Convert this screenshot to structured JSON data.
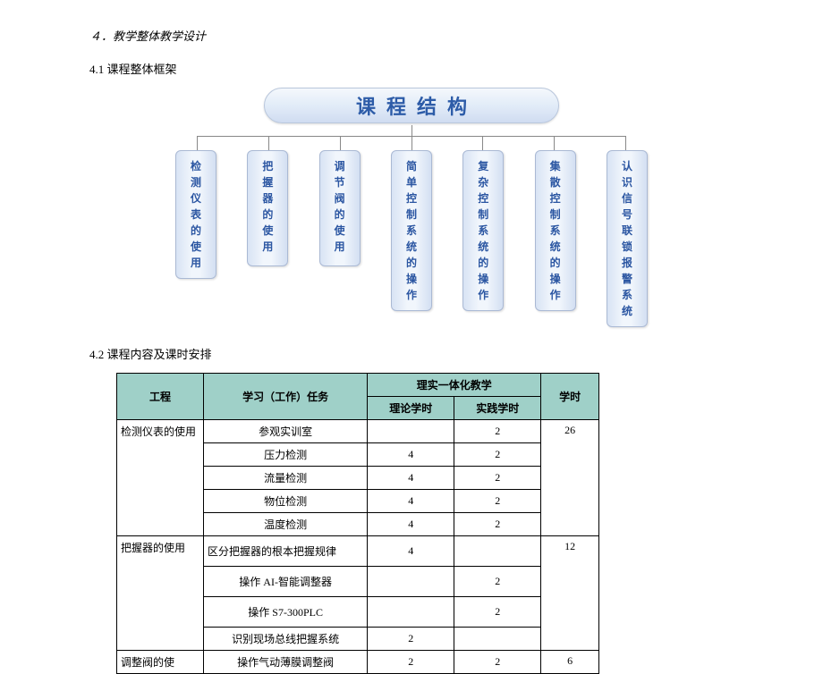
{
  "headings": {
    "section4": "４．教学整体教学设计",
    "sub41": "4.1  课程整体框架",
    "sub42": "4.2  课程内容及课时安排"
  },
  "diagram": {
    "title": "课程结构",
    "boxes": [
      [
        "检",
        "测",
        "仪",
        "表",
        "的",
        "使",
        "用"
      ],
      [
        "把",
        "握",
        "器",
        "的",
        "使",
        "用"
      ],
      [
        "调",
        "节",
        "阀",
        "的",
        "使",
        "用"
      ],
      [
        "简",
        "单",
        "控",
        "制",
        "系",
        "统",
        "的",
        "操",
        "作"
      ],
      [
        "复",
        "杂",
        "控",
        "制",
        "系",
        "统",
        "的",
        "操",
        "作"
      ],
      [
        "集",
        "散",
        "控",
        "制",
        "系",
        "统",
        "的",
        "操",
        "作"
      ],
      [
        "认",
        "识",
        "信",
        "号",
        "联",
        "锁",
        "报",
        "警",
        "系",
        "统"
      ]
    ]
  },
  "table": {
    "headers": {
      "col_project": "工程",
      "col_task": "学习（工作）任务",
      "col_integrated": "理实一体化教学",
      "col_theory": "理论学时",
      "col_practice": "实践学时",
      "col_hours": "学时"
    },
    "rows": [
      {
        "project": "检测仪表的使用",
        "task": "参观实训室",
        "theory": "",
        "practice": "2",
        "hours": "26",
        "project_rowspan": 5,
        "hours_rowspan": 5
      },
      {
        "task": "压力检测",
        "theory": "4",
        "practice": "2"
      },
      {
        "task": "流量检测",
        "theory": "4",
        "practice": "2"
      },
      {
        "task": "物位检测",
        "theory": "4",
        "practice": "2"
      },
      {
        "task": "温度检测",
        "theory": "4",
        "practice": "2"
      },
      {
        "project": "把握器的使用",
        "task": "区分把握器的根本把握规律",
        "theory": "4",
        "practice": "",
        "hours": "12",
        "project_rowspan": 4,
        "hours_rowspan": 4,
        "tall": true
      },
      {
        "task": "操作 AI-智能调整器",
        "theory": "",
        "practice": "2",
        "tall": true
      },
      {
        "task": "操作 S7-300PLC",
        "theory": "",
        "practice": "2",
        "tall": true
      },
      {
        "task": "识别现场总线把握系统",
        "theory": "2",
        "practice": "",
        "tall": false
      },
      {
        "project": "调整阀的使",
        "task": "操作气动薄膜调整阀",
        "theory": "2",
        "practice": "2",
        "hours": "6",
        "project_rowspan": 1,
        "hours_rowspan": 1
      }
    ]
  }
}
